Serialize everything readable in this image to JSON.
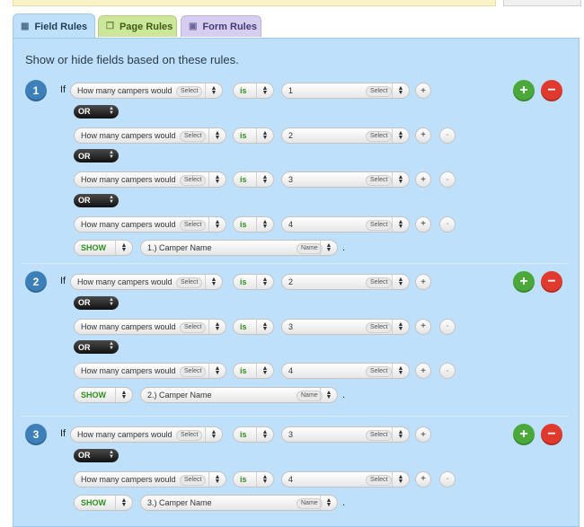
{
  "tabs": [
    {
      "label": "Field Rules",
      "icon": "list-icon"
    },
    {
      "label": "Page Rules",
      "icon": "pages-icon"
    },
    {
      "label": "Form Rules",
      "icon": "form-icon"
    }
  ],
  "heading": "Show or hide fields based on these rules.",
  "if_label": "If",
  "or_label": "OR",
  "period": ".",
  "rules": [
    {
      "number": "1",
      "conditions": [
        {
          "field": "How many campers would",
          "field_badge": "Select",
          "op": "is",
          "value": "1",
          "value_badge": "Select"
        },
        {
          "field": "How many campers would",
          "field_badge": "Select",
          "op": "is",
          "value": "2",
          "value_badge": "Select"
        },
        {
          "field": "How many campers would",
          "field_badge": "Select",
          "op": "is",
          "value": "3",
          "value_badge": "Select"
        },
        {
          "field": "How many campers would",
          "field_badge": "Select",
          "op": "is",
          "value": "4",
          "value_badge": "Select"
        }
      ],
      "action": "SHOW",
      "target": "1.) Camper Name",
      "target_badge": "Name"
    },
    {
      "number": "2",
      "conditions": [
        {
          "field": "How many campers would",
          "field_badge": "Select",
          "op": "is",
          "value": "2",
          "value_badge": "Select"
        },
        {
          "field": "How many campers would",
          "field_badge": "Select",
          "op": "is",
          "value": "3",
          "value_badge": "Select"
        },
        {
          "field": "How many campers would",
          "field_badge": "Select",
          "op": "is",
          "value": "4",
          "value_badge": "Select"
        }
      ],
      "action": "SHOW",
      "target": "2.) Camper Name",
      "target_badge": "Name"
    },
    {
      "number": "3",
      "conditions": [
        {
          "field": "How many campers would",
          "field_badge": "Select",
          "op": "is",
          "value": "3",
          "value_badge": "Select"
        },
        {
          "field": "How many campers would",
          "field_badge": "Select",
          "op": "is",
          "value": "4",
          "value_badge": "Select"
        }
      ],
      "action": "SHOW",
      "target": "3.) Camper Name",
      "target_badge": "Name"
    }
  ],
  "colors": {
    "panel": "#bfe0fb",
    "add": "#4aa93a",
    "remove": "#e0392e",
    "number": "#3d7fb8",
    "green_text": "#2f8f1f"
  }
}
